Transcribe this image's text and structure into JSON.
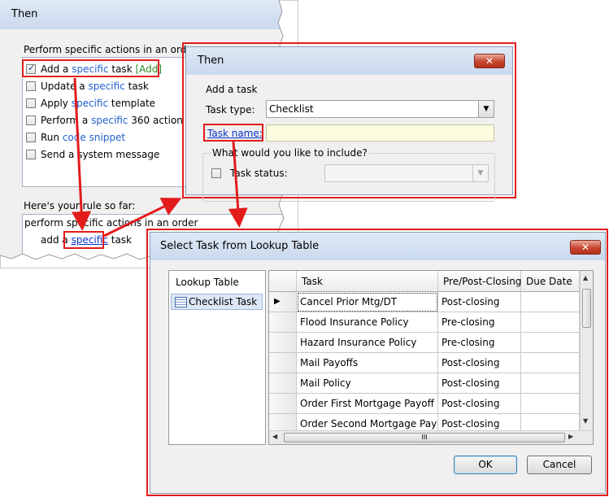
{
  "window1": {
    "title": "Then",
    "actions_group_label": "Perform specific actions in an order",
    "actions": [
      {
        "prefix": "Add a ",
        "link": "specific",
        "suffix": " task ",
        "extra": "[Add]",
        "checked": true
      },
      {
        "prefix": "Update a ",
        "link": "specific",
        "suffix": " task",
        "checked": false
      },
      {
        "prefix": "Apply ",
        "link": "specific",
        "suffix": " template",
        "checked": false
      },
      {
        "prefix": "Perform a ",
        "link": "specific",
        "suffix": " 360 action",
        "checked": false
      },
      {
        "prefix": "Run ",
        "link": "code snippet",
        "suffix": "",
        "checked": false
      },
      {
        "prefix": "Send a system message",
        "link": "",
        "suffix": "",
        "checked": false
      }
    ],
    "rule_label": "Here's your rule so far:",
    "rule_line1": "perform specific actions in an order",
    "rule_line2_prefix": "add a ",
    "rule_line2_link": "specific",
    "rule_line2_suffix": " task"
  },
  "window2": {
    "title": "Then",
    "close_label": "✕",
    "heading": "Add a task",
    "task_type_label": "Task type:",
    "task_type_value": "Checklist",
    "task_name_label": "Task name:",
    "task_name_value": "",
    "include_label": "What would you like to include?",
    "task_status_label": "Task status:"
  },
  "window3": {
    "title": "Select Task from Lookup Table",
    "close_label": "✕",
    "lookup_header": "Lookup Table",
    "lookup_item": "Checklist Task",
    "columns": [
      "Task",
      "Pre/Post-Closing",
      "Due Date"
    ],
    "rows": [
      {
        "task": "Cancel Prior Mtg/DT",
        "closing": "Post-closing",
        "due": ""
      },
      {
        "task": "Flood Insurance Policy",
        "closing": "Pre-closing",
        "due": ""
      },
      {
        "task": "Hazard Insurance Policy",
        "closing": "Pre-closing",
        "due": ""
      },
      {
        "task": "Mail Payoffs",
        "closing": "Post-closing",
        "due": ""
      },
      {
        "task": "Mail Policy",
        "closing": "Post-closing",
        "due": ""
      },
      {
        "task": "Order First Mortgage Payoff",
        "closing": "Post-closing",
        "due": ""
      },
      {
        "task": "Order Second Mortgage Payoff",
        "closing": "Post-closing",
        "due": ""
      }
    ],
    "ok_label": "OK",
    "cancel_label": "Cancel",
    "hscroll_grip": "III"
  },
  "colors": {
    "highlight": "#e31b1b",
    "link_blue": "#1f5fcf",
    "add_green": "#2c8a2c"
  }
}
